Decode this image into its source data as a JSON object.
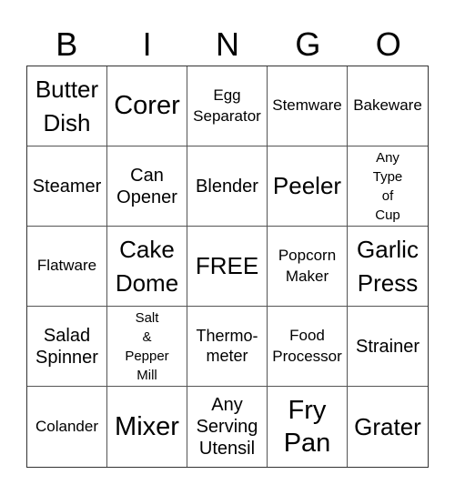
{
  "title_letters": [
    "B",
    "I",
    "N",
    "G",
    "O"
  ],
  "cells": [
    {
      "text": "Butter\nDish",
      "size": "s-l"
    },
    {
      "text": "Corer",
      "size": "s-xl"
    },
    {
      "text": "Egg\nSeparator",
      "size": "s-s"
    },
    {
      "text": "Stemware",
      "size": "s-s"
    },
    {
      "text": "Bakeware",
      "size": "s-s"
    },
    {
      "text": "Steamer",
      "size": "s-m"
    },
    {
      "text": "Can\nOpener",
      "size": "s-m"
    },
    {
      "text": "Blender",
      "size": "s-m"
    },
    {
      "text": "Peeler",
      "size": "s-l"
    },
    {
      "text": "Any\nType\nof\nCup",
      "size": "s-xs"
    },
    {
      "text": "Flatware",
      "size": "s-s"
    },
    {
      "text": "Cake\nDome",
      "size": "s-l"
    },
    {
      "text": "FREE",
      "size": "s-l"
    },
    {
      "text": "Popcorn\nMaker",
      "size": "s-s"
    },
    {
      "text": "Garlic\nPress",
      "size": "s-l"
    },
    {
      "text": "Salad\nSpinner",
      "size": "s-m"
    },
    {
      "text": "Salt\n&\nPepper\nMill",
      "size": "s-xs"
    },
    {
      "text": "Thermo-\nmeter",
      "size": "s-sm"
    },
    {
      "text": "Food\nProcessor",
      "size": "s-s"
    },
    {
      "text": "Strainer",
      "size": "s-m"
    },
    {
      "text": "Colander",
      "size": "s-s"
    },
    {
      "text": "Mixer",
      "size": "s-xl"
    },
    {
      "text": "Any\nServing\nUtensil",
      "size": "s-m"
    },
    {
      "text": "Fry\nPan",
      "size": "s-xl"
    },
    {
      "text": "Grater",
      "size": "s-l"
    }
  ]
}
